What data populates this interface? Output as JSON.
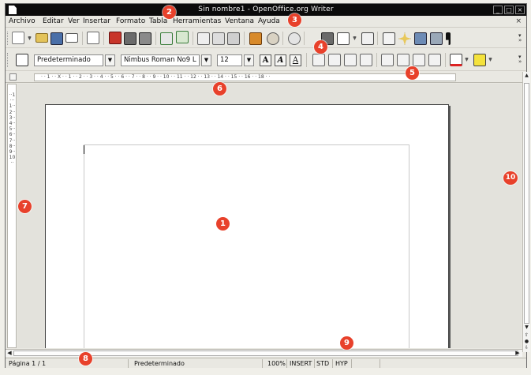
{
  "window": {
    "title": "Sin nombre1 - OpenOffice.org Writer",
    "buttons": [
      "_",
      "□",
      "×"
    ]
  },
  "menu": {
    "items": [
      "Archivo",
      "Editar",
      "Ver",
      "Insertar",
      "Formato",
      "Tabla",
      "Herramientas",
      "Ventana",
      "Ayuda"
    ],
    "close_doc": "×"
  },
  "format_toolbar": {
    "style": "Predeterminado",
    "font": "Nimbus Roman No9 L",
    "size": "12",
    "bold": "A",
    "italic": "A",
    "underline": "A"
  },
  "ruler": {
    "marks": "· · 1 · · X · · 1 · · 2 · · 3 · · 4 · · 5 · · 6 · · 7 · · 8 · · 9 · · 10 · · 11 · · 12 · · 13 · · 14 · · 15 · · 16 · · 18 · ·"
  },
  "vruler": {
    "marks": "··1···1··2··3··4··5··6··7··8··9··10··"
  },
  "status": {
    "page": "Página  1 / 1",
    "style": "Predeterminado",
    "zoom": "100%",
    "mode": "INSERT",
    "selection": "STD",
    "hyperlink": "HYP"
  },
  "callouts": [
    "1",
    "2",
    "3",
    "4",
    "5",
    "6",
    "7",
    "8",
    "9",
    "10"
  ],
  "colors": {
    "callout": "#e8412b",
    "titlebar": "#0b0b0b"
  }
}
